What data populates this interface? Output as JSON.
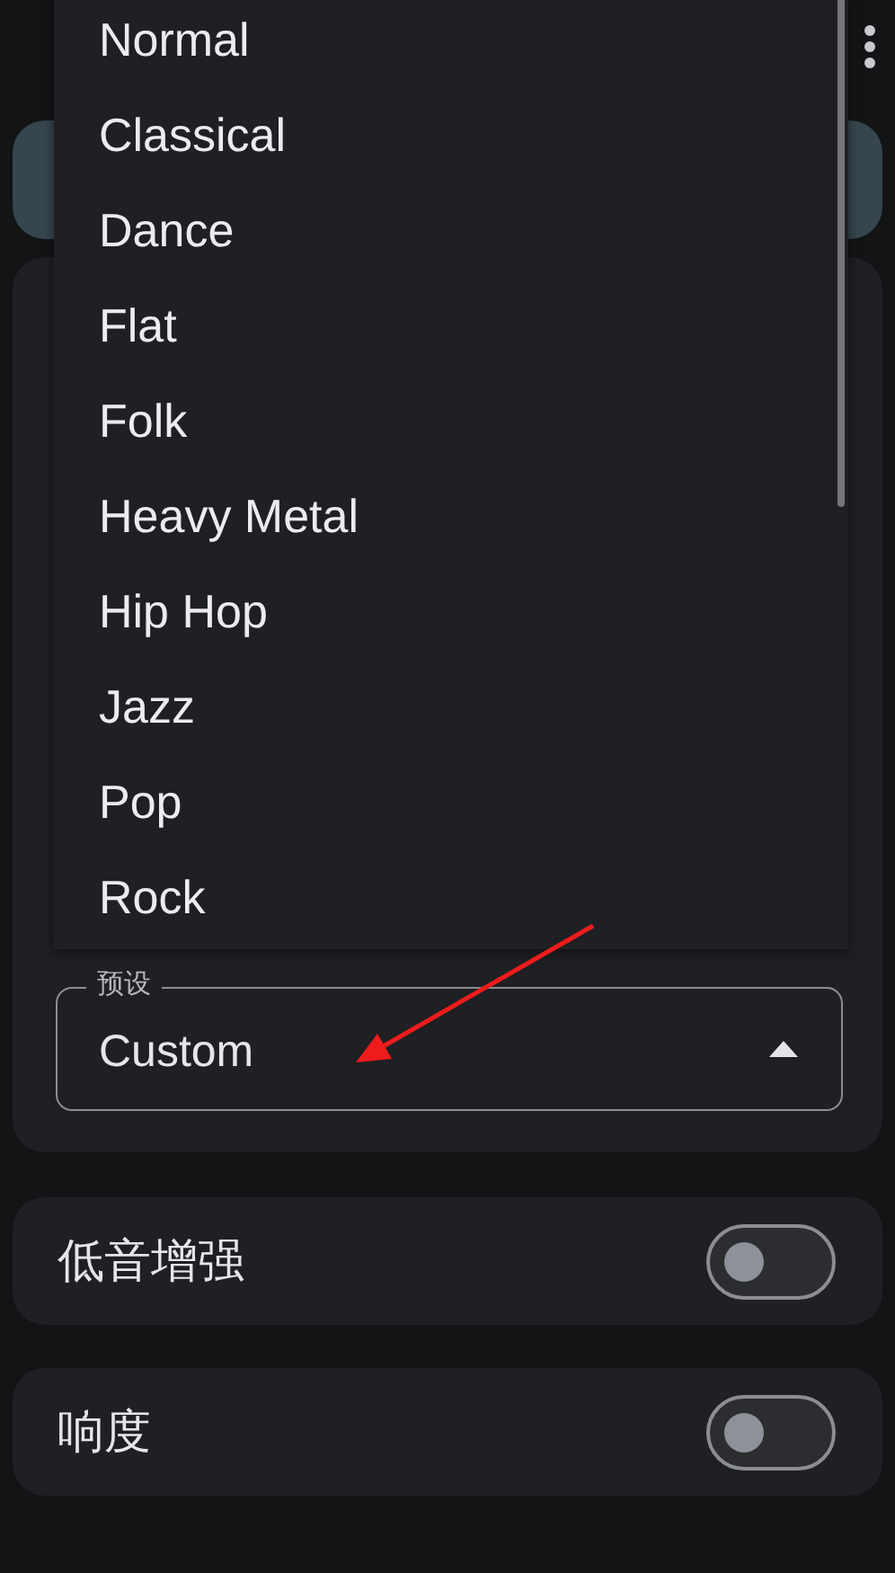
{
  "preset_dropdown": {
    "label": "预设",
    "value": "Custom",
    "expanded": true,
    "options": [
      "Normal",
      "Classical",
      "Dance",
      "Flat",
      "Folk",
      "Heavy Metal",
      "Hip Hop",
      "Jazz",
      "Pop",
      "Rock"
    ]
  },
  "toggles": [
    {
      "label": "低音增强",
      "on": false
    },
    {
      "label": "响度",
      "on": false
    }
  ]
}
